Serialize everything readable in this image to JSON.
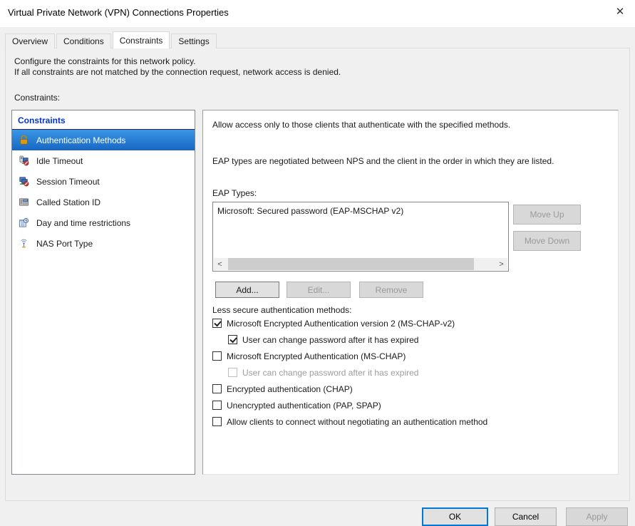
{
  "window": {
    "title": "Virtual Private Network (VPN) Connections Properties",
    "close_glyph": "✕"
  },
  "tabs": [
    {
      "label": "Overview"
    },
    {
      "label": "Conditions"
    },
    {
      "label": "Constraints"
    },
    {
      "label": "Settings"
    }
  ],
  "intro": {
    "line1": "Configure the constraints for this network policy.",
    "line2": "If all constraints are not matched by the connection request, network access is denied."
  },
  "constraints_label": "Constraints:",
  "left_list": {
    "header": "Constraints",
    "items": [
      {
        "label": "Authentication Methods",
        "icon": "lock-icon",
        "selected": true
      },
      {
        "label": "Idle Timeout",
        "icon": "idle-timeout-icon",
        "selected": false
      },
      {
        "label": "Session Timeout",
        "icon": "session-timeout-icon",
        "selected": false
      },
      {
        "label": "Called Station ID",
        "icon": "called-station-id-icon",
        "selected": false
      },
      {
        "label": "Day and time restrictions",
        "icon": "day-time-restrictions-icon",
        "selected": false
      },
      {
        "label": "NAS Port Type",
        "icon": "nas-port-type-icon",
        "selected": false
      }
    ]
  },
  "right": {
    "description": "Allow access only to those clients that authenticate with the specified methods.",
    "negotiation_text": "EAP types are negotiated between NPS and the client in the order in which they are listed.",
    "eap_types_label": "EAP Types:",
    "eap_list": [
      "Microsoft: Secured password (EAP-MSCHAP v2)"
    ],
    "scrollbar": {
      "left_arrow": "<",
      "right_arrow": ">"
    },
    "move_up_label": "Move Up",
    "move_down_label": "Move Down",
    "add_label": "Add...",
    "edit_label": "Edit...",
    "remove_label": "Remove",
    "less_secure_label": "Less secure authentication methods:",
    "checkboxes": [
      {
        "label": "Microsoft Encrypted Authentication version 2 (MS-CHAP-v2)",
        "checked": true,
        "indent": false,
        "disabled": false
      },
      {
        "label": "User can change password after it has expired",
        "checked": true,
        "indent": true,
        "disabled": false
      },
      {
        "label": "Microsoft Encrypted Authentication (MS-CHAP)",
        "checked": false,
        "indent": false,
        "disabled": false
      },
      {
        "label": "User can change password after it has expired",
        "checked": false,
        "indent": true,
        "disabled": true
      },
      {
        "label": "Encrypted authentication (CHAP)",
        "checked": false,
        "indent": false,
        "disabled": false
      },
      {
        "label": "Unencrypted authentication (PAP, SPAP)",
        "checked": false,
        "indent": false,
        "disabled": false
      },
      {
        "label": "Allow clients to connect without negotiating an authentication method",
        "checked": false,
        "indent": false,
        "disabled": false
      }
    ]
  },
  "footer": {
    "ok_label": "OK",
    "cancel_label": "Cancel",
    "apply_label": "Apply"
  },
  "colors": {
    "accent": "#0078d7",
    "selection_top": "#3b97e4",
    "selection_bottom": "#1766c4",
    "list_header_blue": "#0033cc",
    "dialog_bg": "#f0f0f0"
  }
}
